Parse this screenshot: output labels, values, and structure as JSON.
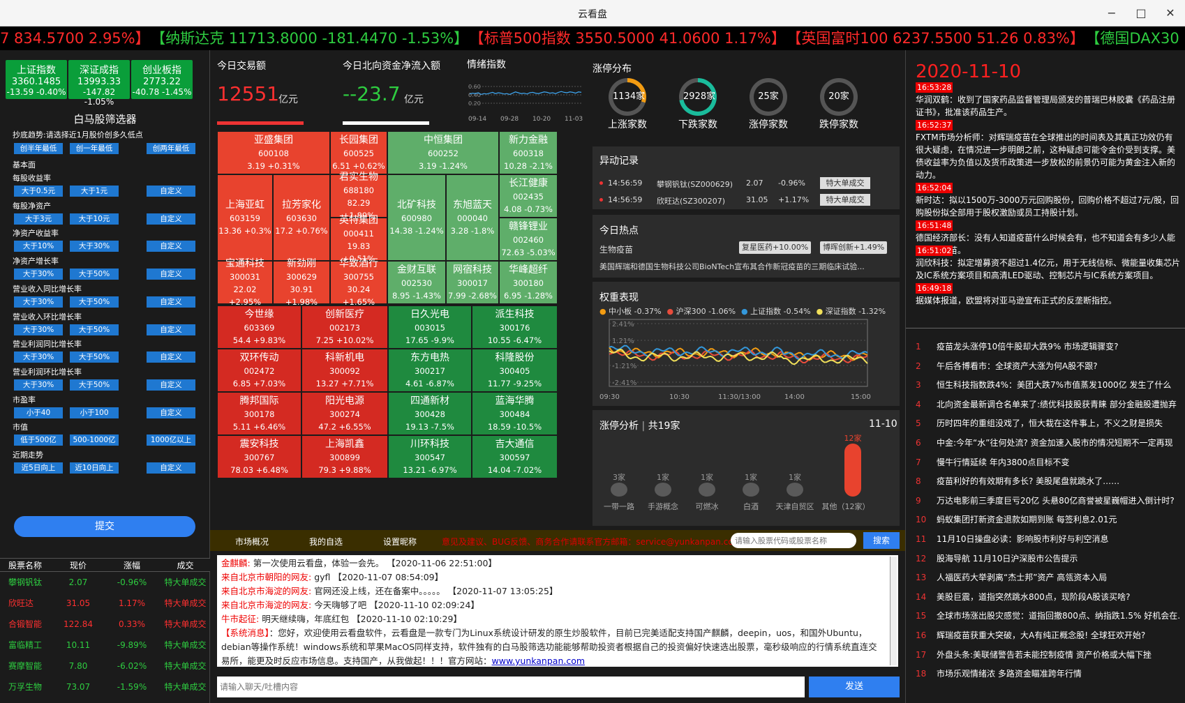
{
  "window": {
    "title": "云看盘"
  },
  "ticker": {
    "items": [
      {
        "text": "7  834.5700  2.95%】",
        "color": "red"
      },
      {
        "text": "【纳斯达克  11713.8000  -181.4470  -1.53%】",
        "color": "green"
      },
      {
        "text": "【标普500指数  3550.5000  41.0600  1.17%】",
        "color": "red"
      },
      {
        "text": "【英国富时100  6237.5500  51.26  0.83%】",
        "color": "red"
      },
      {
        "text": "【德国DAX30",
        "color": "green"
      }
    ]
  },
  "indices": [
    {
      "name": "上证指数",
      "value": "3360.1485",
      "change": "-13.59 -0.40%"
    },
    {
      "name": "深证成指",
      "value": "13993.33",
      "change": "-147.82 -1.05%"
    },
    {
      "name": "创业板指",
      "value": "2773.22",
      "change": "-40.78 -1.45%"
    }
  ],
  "screener": {
    "title": "白马股筛选器",
    "trend_label": "抄底趋势:请选择近1月股价创多久低点",
    "trend_options": [
      "创半年最低",
      "创一年最低",
      "创两年最低"
    ],
    "basic_label": "基本面",
    "groups": [
      {
        "label": "每股收益率",
        "options": [
          "大于0.5元",
          "大于1元",
          "自定义"
        ]
      },
      {
        "label": "每股净资产",
        "options": [
          "大于3元",
          "大于10元",
          "自定义"
        ]
      },
      {
        "label": "净资产收益率",
        "options": [
          "大于10%",
          "大于30%",
          "自定义"
        ]
      },
      {
        "label": "净资产增长率",
        "options": [
          "大于30%",
          "大于50%",
          "自定义"
        ]
      },
      {
        "label": "营业收入同比增长率",
        "options": [
          "大于30%",
          "大于50%",
          "自定义"
        ]
      },
      {
        "label": "营业收入环比增长率",
        "options": [
          "大于30%",
          "大于50%",
          "自定义"
        ]
      },
      {
        "label": "营业利润同比增长率",
        "options": [
          "大于30%",
          "大于50%",
          "自定义"
        ]
      },
      {
        "label": "营业利润环比增长率",
        "options": [
          "大于30%",
          "大于50%",
          "自定义"
        ]
      },
      {
        "label": "市盈率",
        "options": [
          "小于40",
          "小于100",
          "自定义"
        ]
      },
      {
        "label": "市值",
        "options": [
          "低于500亿",
          "500-1000亿",
          "1000亿以上"
        ]
      },
      {
        "label": "近期走势",
        "options": [
          "近5日向上",
          "近10日向上",
          "自定义"
        ]
      }
    ],
    "submit": "提交"
  },
  "stock_table": {
    "headers": [
      "股票名称",
      "现价",
      "涨幅",
      "成交"
    ],
    "rows": [
      {
        "name": "攀钢钒钛",
        "price": "2.07",
        "chg": "-0.96%",
        "deal": "特大单成交",
        "up": false
      },
      {
        "name": "欣旺达",
        "price": "31.05",
        "chg": "1.17%",
        "deal": "特大单成交",
        "up": true
      },
      {
        "name": "合锻智能",
        "price": "122.84",
        "chg": "0.33%",
        "deal": "特大单成交",
        "up": true
      },
      {
        "name": "富临精工",
        "price": "10.11",
        "chg": "-9.89%",
        "deal": "特大单成交",
        "up": false
      },
      {
        "name": "赛摩智能",
        "price": "7.80",
        "chg": "-6.02%",
        "deal": "特大单成交",
        "up": false
      },
      {
        "name": "万孚生物",
        "price": "73.07",
        "chg": "-1.59%",
        "deal": "特大单成交",
        "up": false
      }
    ]
  },
  "today": {
    "volume_label": "今日交易额",
    "volume": "12551",
    "volume_unit": "亿元",
    "north_label": "今日北向资金净流入额",
    "north": "--23.7",
    "north_unit": "亿元",
    "sentiment_label": "情绪指数",
    "sentiment_ticks": [
      "0.60",
      "0.40",
      "0.20"
    ],
    "sentiment_dates": [
      "09-14",
      "09-28",
      "10-20",
      "11-03"
    ],
    "sentiment_values": [
      0.42,
      0.44,
      0.43,
      0.45,
      0.41,
      0.43,
      0.42,
      0.44,
      0.46,
      0.43,
      0.45,
      0.44,
      0.42,
      0.43,
      0.41,
      0.44,
      0.47,
      0.45,
      0.43,
      0.44,
      0.42,
      0.45,
      0.46,
      0.44,
      0.43,
      0.45,
      0.47,
      0.46,
      0.44,
      0.45,
      0.43,
      0.46,
      0.48,
      0.46,
      0.45,
      0.47,
      0.46,
      0.44,
      0.47,
      0.46
    ]
  },
  "heatmap": [
    {
      "name": "亚盛集团",
      "code": "600108",
      "val": "3.19 +0.31%",
      "c": "r"
    },
    {
      "name": "长园集团",
      "code": "600525",
      "val": "6.51 +0.62%",
      "c": "r"
    },
    {
      "name": "中恒集团",
      "code": "600252",
      "val": "3.19 -1.24%",
      "c": "g"
    },
    {
      "name": "新力金融",
      "code": "600318",
      "val": "10.28 -2.1%",
      "c": "g"
    },
    {
      "name": "上海亚虹",
      "code": "603159",
      "val": "13.36 +0.3%",
      "c": "r"
    },
    {
      "name": "拉芳家化",
      "code": "603630",
      "val": "17.2 +0.76%",
      "c": "r"
    },
    {
      "name": "君实生物",
      "code": "688180",
      "val": "82.29 +1.89%",
      "c": "r"
    },
    {
      "name": "北矿科技",
      "code": "600980",
      "val": "14.38 -1.24%",
      "c": "g"
    },
    {
      "name": "东旭蓝天",
      "code": "000040",
      "val": "3.28 -1.8%",
      "c": "g"
    },
    {
      "name": "长江健康",
      "code": "002435",
      "val": "4.08 -0.73%",
      "c": "g"
    },
    {
      "name": "英特集团",
      "code": "000411",
      "val": "19.83 +0.51%",
      "c": "r"
    },
    {
      "name": "赣锋锂业",
      "code": "002460",
      "val": "72.63 -5.03%",
      "c": "g"
    },
    {
      "name": "宝通科技",
      "code": "300031",
      "val": "22.02 +2.95%",
      "c": "r"
    },
    {
      "name": "新劲刚",
      "code": "300629",
      "val": "30.91 +1.98%",
      "c": "r"
    },
    {
      "name": "华致酒行",
      "code": "300755",
      "val": "30.24 +1.65%",
      "c": "r"
    },
    {
      "name": "金财互联",
      "code": "002530",
      "val": "8.95 -1.43%",
      "c": "g"
    },
    {
      "name": "网宿科技",
      "code": "300017",
      "val": "7.99 -2.68%",
      "c": "g"
    },
    {
      "name": "华峰超纤",
      "code": "300180",
      "val": "6.95 -1.28%",
      "c": "g"
    },
    {
      "name": "今世缘",
      "code": "603369",
      "val": "54.4 +9.83%",
      "c": "R"
    },
    {
      "name": "创新医疗",
      "code": "002173",
      "val": "7.25 +10.02%",
      "c": "R"
    },
    {
      "name": "日久光电",
      "code": "003015",
      "val": "17.65 -9.9%",
      "c": "G"
    },
    {
      "name": "派生科技",
      "code": "300176",
      "val": "10.55 -6.47%",
      "c": "G"
    },
    {
      "name": "双环传动",
      "code": "002472",
      "val": "6.85 +7.03%",
      "c": "R"
    },
    {
      "name": "科新机电",
      "code": "300092",
      "val": "13.27 +7.71%",
      "c": "R"
    },
    {
      "name": "东方电热",
      "code": "300217",
      "val": "4.61 -6.87%",
      "c": "G"
    },
    {
      "name": "科隆股份",
      "code": "300405",
      "val": "11.77 -9.25%",
      "c": "G"
    },
    {
      "name": "腾邦国际",
      "code": "300178",
      "val": "5.11 +6.46%",
      "c": "R"
    },
    {
      "name": "阳光电源",
      "code": "300274",
      "val": "47.2 +6.55%",
      "c": "R"
    },
    {
      "name": "四通新材",
      "code": "300428",
      "val": "19.13 -7.5%",
      "c": "G"
    },
    {
      "name": "蓝海华腾",
      "code": "300484",
      "val": "18.59 -10.5%",
      "c": "G"
    },
    {
      "name": "震安科技",
      "code": "300767",
      "val": "78.03 +6.48%",
      "c": "R"
    },
    {
      "name": "上海凯鑫",
      "code": "300899",
      "val": "79.3 +9.88%",
      "c": "R"
    },
    {
      "name": "川环科技",
      "code": "300547",
      "val": "13.21 -6.97%",
      "c": "G"
    },
    {
      "name": "吉大通信",
      "code": "300597",
      "val": "14.04 -7.02%",
      "c": "G"
    }
  ],
  "distribution": {
    "title": "涨停分布",
    "rings": [
      {
        "count": "1134家",
        "label": "上涨家数",
        "frac": 0.3,
        "color": "#f39c12"
      },
      {
        "count": "2928家",
        "label": "下跌家数",
        "frac": 0.72,
        "color": "#1abc9c"
      },
      {
        "count": "25家",
        "label": "涨停家数",
        "frac": 0.0,
        "color": "#888"
      },
      {
        "count": "20家",
        "label": "跌停家数",
        "frac": 0.0,
        "color": "#888"
      }
    ]
  },
  "anomaly": {
    "title": "异动记录",
    "rows": [
      {
        "time": "14:56:59",
        "stock": "攀钢钒钛(SZ000629)",
        "price": "2.07",
        "chg": "-0.96%",
        "tag": "特大单成交"
      },
      {
        "time": "14:56:59",
        "stock": "欣旺达(SZ300207)",
        "price": "31.05",
        "chg": "+1.17%",
        "tag": "特大单成交"
      }
    ]
  },
  "hot": {
    "title": "今日热点",
    "topic": "生物疫苗",
    "tags": [
      "复星医药+10.00%",
      "博晖创新+1.49%"
    ],
    "desc": "美国辉瑞和德国生物科技公司BioNTech宣布其合作新冠疫苗的三期临床试验..."
  },
  "weights": {
    "title": "权重表现",
    "legend": [
      {
        "name": "中小板 -0.37%",
        "color": "#f39c12"
      },
      {
        "name": "沪深300 -1.06%",
        "color": "#e74c3c"
      },
      {
        "name": "上证指数 -0.54%",
        "color": "#3498db"
      },
      {
        "name": "深证指数 -1.32%",
        "color": "#f1e05a"
      }
    ],
    "yticks": [
      "2.41%",
      "1.21%",
      "-1.21%",
      "-2.41%"
    ],
    "xticks": [
      "09:30",
      "10:30",
      "11:30/13:00",
      "14:00",
      "15:00"
    ]
  },
  "limit": {
    "title": "涨停分析",
    "count": "共19家",
    "date": "11-10",
    "bars": [
      {
        "label": "一带一路",
        "n": "3家",
        "v": 3
      },
      {
        "label": "手游概念",
        "n": "1家",
        "v": 1
      },
      {
        "label": "可燃冰",
        "n": "1家",
        "v": 1
      },
      {
        "label": "白酒",
        "n": "1家",
        "v": 1
      },
      {
        "label": "天津自贸区",
        "n": "1家",
        "v": 1
      },
      {
        "label": "其他（12家）",
        "n": "12家",
        "v": 12
      }
    ]
  },
  "nav": {
    "tabs": [
      "市场概况",
      "我的自选",
      "设置昵称"
    ],
    "notice": "意见及建议、BUG反馈、商务合作请联系官方邮箱：service@yunkanpan.com",
    "search_placeholder": "请输入股票代码或股票名称",
    "search_btn": "搜索"
  },
  "chat": {
    "lines": [
      {
        "user": "金麒麟:",
        "text": " 第一次使用云看盘，体验一会先。 【2020-11-06 22:51:00】"
      },
      {
        "user": "来自北京市朝阳的网友:",
        "text": " gyfl 【2020-11-07 08:54:09】"
      },
      {
        "user": "来自北京市海淀的网友:",
        "text": " 官网还没上线，还在备案中。。。。。 【2020-11-07 13:05:25】"
      },
      {
        "user": "来自北京市海淀的网友:",
        "text": " 今天嗨够了吧 【2020-11-10 02:09:24】"
      },
      {
        "user": "牛市起征:",
        "text": " 明天继续嗨，年底红包 【2020-11-10 02:10:29】"
      },
      {
        "user": "【系统消息】",
        "text": "：您好，欢迎使用云看盘软件，云看盘是一款专门为Linux系统设计研发的原生炒股软件，目前已完美适配支持国产麒麟，deepin，uos，和国外Ubuntu，debian等操作系统！windows系统和苹果MacOS同样支持，软件独有的白马股筛选功能能够帮助投资者根据自己的投资偏好快速选出股票，毫秒级响应的行情系统直连交易所，能更及时反应市场信息。支持国产，从我做起！！！官方网站："
      }
    ],
    "link": "www.yunkanpan.com",
    "input_placeholder": "请输入聊天/吐槽内容",
    "send": "发送"
  },
  "news": {
    "date": "2020-11-10",
    "items": [
      {
        "time": "16:53:28",
        "text": "华润双鹤：收到了国家药品监督管理局颁发的普瑞巴林胶囊《药品注册证书》，批准该药品生产。"
      },
      {
        "time": "16:52:37",
        "text": "FXTM市场分析师：对辉瑞疫苗在全球推出的时间表及其真正功效仍有很大疑虑，在情况进一步明朗之前，这种疑虑可能令金价受到支撑。美债收益率为负值以及货币政策进一步放松的前景仍可能为黄金注入新的动力。"
      },
      {
        "time": "16:52:04",
        "text": "新时达：拟以1500万-3000万元回购股份，回购价格不超过7元/股，回购股份拟全部用于股权激励或员工持股计划。"
      },
      {
        "time": "16:51:48",
        "text": "德国经济部长：没有人知道疫苗什么时候会有，也不知道会有多少人能够得到疫苗。"
      },
      {
        "time": "16:51:02",
        "text": "润欣科技：拟定增募资不超过1.4亿元，用于无线信标、微能量收集芯片及IC系统方案项目和高清LED驱动、控制芯片与IC系统方案项目。"
      },
      {
        "time": "16:49:18",
        "text": "据媒体报道，欧盟将对亚马逊宣布正式的反垄断指控。"
      }
    ]
  },
  "headlines": [
    "疫苗龙头涨停10倍牛股却大跌9% 市场逻辑骤变?",
    "午后各博看市：全球资产大涨为何A股不跟?",
    "恒生科技指数跌4%：美团大跌7%市值蒸发1000亿 发生了什么",
    "北向资金最新调仓名单来了:绩优科技股获青睐 部分金融股遭抛弃",
    "历时四年的重组没戏了，恒大栽在这件事上，不义之财是损失",
    "中金:今年“水”往何处流? 资金加速入股市的情况短期不一定再现",
    "慢牛行情延续 年内3800点目标不变",
    "疫苗利好的有效期有多长? 美股尾盘就跳水了……",
    "万达电影前三季度巨亏20亿 头悬80亿商誉被星巍帽进入倒计时?",
    "蚂蚁集团打新资金退款如期到账 每签利息2.01元",
    "11月10日操盘必读：影响股市利好与利空消息",
    "股海导航 11月10日沪深股市公告提示",
    "人福医药大举剥离“杰士邦”资产 高瓴资本入局",
    "美股巨震，道指突然跳水800点，现阶段A股该买啥?",
    "全球市场涨出股灾感觉：道指回撤800点、纳指跌1.5% 好机会在…",
    "辉瑞疫苗获重大突破，大A有纯正概念股! 全球狂欢开始?",
    "外盘头条:美联储警告若未能控制疫情 资产价格或大幅下挫",
    "市场乐观情绪浓 多路资金瞄准跨年行情"
  ]
}
